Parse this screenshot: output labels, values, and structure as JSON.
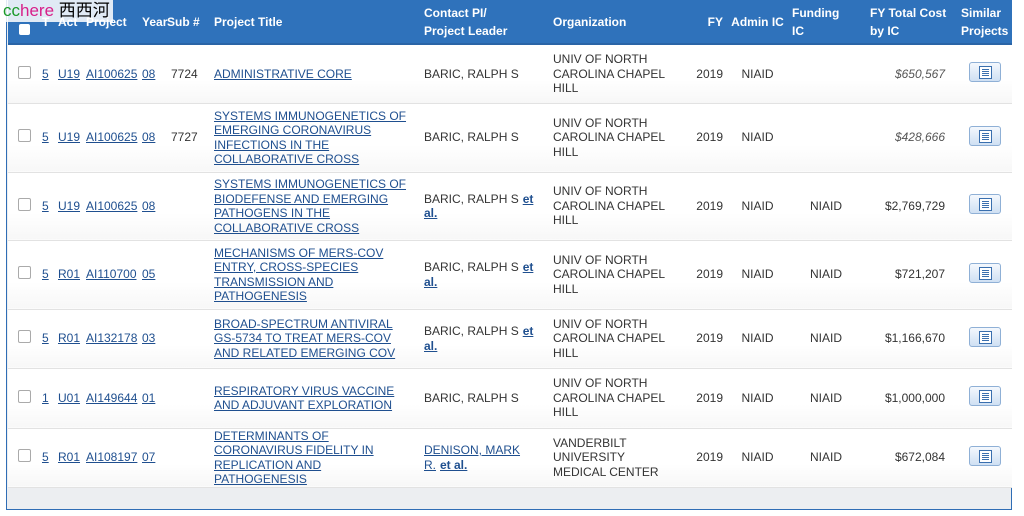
{
  "watermark": {
    "part1": "cc",
    "part2": "here",
    "part3": "西西河"
  },
  "headers": {
    "t": "T",
    "act": "Act",
    "project": "Project",
    "year": "Year",
    "sub": "Sub #",
    "title": "Project Title",
    "pi_line1": "Contact PI/",
    "pi_line2": "Project Leader",
    "org": "Organization",
    "fy": "FY",
    "admin_ic": "Admin IC",
    "funding_line1": "Funding",
    "funding_line2": "IC",
    "cost_line1": "FY Total Cost",
    "cost_line2": "by IC",
    "similar_line1": "Similar",
    "similar_line2": "Projects"
  },
  "etal_label": "et al.",
  "rows": [
    {
      "t": "5",
      "act": "U19",
      "project": "AI100625",
      "year": "08",
      "sub": "7724",
      "title": "ADMINISTRATIVE CORE",
      "pi": "BARIC, RALPH S",
      "pi_link": false,
      "etal": false,
      "org": "UNIV OF NORTH CAROLINA CHAPEL HILL",
      "fy": "2019",
      "admin_ic": "NIAID",
      "funding_ic": "",
      "cost": "$650,567",
      "cost_italic": true
    },
    {
      "t": "5",
      "act": "U19",
      "project": "AI100625",
      "year": "08",
      "sub": "7727",
      "title": "SYSTEMS IMMUNOGENETICS OF EMERGING CORONAVIRUS INFECTIONS IN THE COLLABORATIVE CROSS",
      "pi": "BARIC, RALPH S",
      "pi_link": false,
      "etal": false,
      "org": "UNIV OF NORTH CAROLINA CHAPEL HILL",
      "fy": "2019",
      "admin_ic": "NIAID",
      "funding_ic": "",
      "cost": "$428,666",
      "cost_italic": true
    },
    {
      "t": "5",
      "act": "U19",
      "project": "AI100625",
      "year": "08",
      "sub": "",
      "title": "SYSTEMS IMMUNOGENETICS OF BIODEFENSE AND EMERGING PATHOGENS IN THE COLLABORATIVE CROSS",
      "pi": "BARIC, RALPH S",
      "pi_link": false,
      "etal": true,
      "org": "UNIV OF NORTH CAROLINA CHAPEL HILL",
      "fy": "2019",
      "admin_ic": "NIAID",
      "funding_ic": "NIAID",
      "cost": "$2,769,729",
      "cost_italic": false
    },
    {
      "t": "5",
      "act": "R01",
      "project": "AI110700",
      "year": "05",
      "sub": "",
      "title": "MECHANISMS OF MERS-COV ENTRY, CROSS-SPECIES TRANSMISSION AND PATHOGENESIS",
      "pi": "BARIC, RALPH S",
      "pi_link": false,
      "etal": true,
      "org": "UNIV OF NORTH CAROLINA CHAPEL HILL",
      "fy": "2019",
      "admin_ic": "NIAID",
      "funding_ic": "NIAID",
      "cost": "$721,207",
      "cost_italic": false
    },
    {
      "t": "5",
      "act": "R01",
      "project": "AI132178",
      "year": "03",
      "sub": "",
      "title": "BROAD-SPECTRUM ANTIVIRAL GS-5734 TO TREAT MERS-COV AND RELATED EMERGING COV",
      "pi": "BARIC, RALPH S",
      "pi_link": false,
      "etal": true,
      "org": "UNIV OF NORTH CAROLINA CHAPEL HILL",
      "fy": "2019",
      "admin_ic": "NIAID",
      "funding_ic": "NIAID",
      "cost": "$1,166,670",
      "cost_italic": false
    },
    {
      "t": "1",
      "act": "U01",
      "project": "AI149644",
      "year": "01",
      "sub": "",
      "title": "RESPIRATORY VIRUS VACCINE AND ADJUVANT EXPLORATION",
      "pi": "BARIC, RALPH S",
      "pi_link": false,
      "etal": false,
      "org": "UNIV OF NORTH CAROLINA CHAPEL HILL",
      "fy": "2019",
      "admin_ic": "NIAID",
      "funding_ic": "NIAID",
      "cost": "$1,000,000",
      "cost_italic": false
    },
    {
      "t": "5",
      "act": "R01",
      "project": "AI108197",
      "year": "07",
      "sub": "",
      "title": "DETERMINANTS OF CORONAVIRUS FIDELITY IN REPLICATION AND PATHOGENESIS",
      "pi": "DENISON, MARK R.",
      "pi_link": true,
      "etal": true,
      "org": "VANDERBILT UNIVERSITY MEDICAL CENTER",
      "fy": "2019",
      "admin_ic": "NIAID",
      "funding_ic": "NIAID",
      "cost": "$672,084",
      "cost_italic": false
    }
  ]
}
